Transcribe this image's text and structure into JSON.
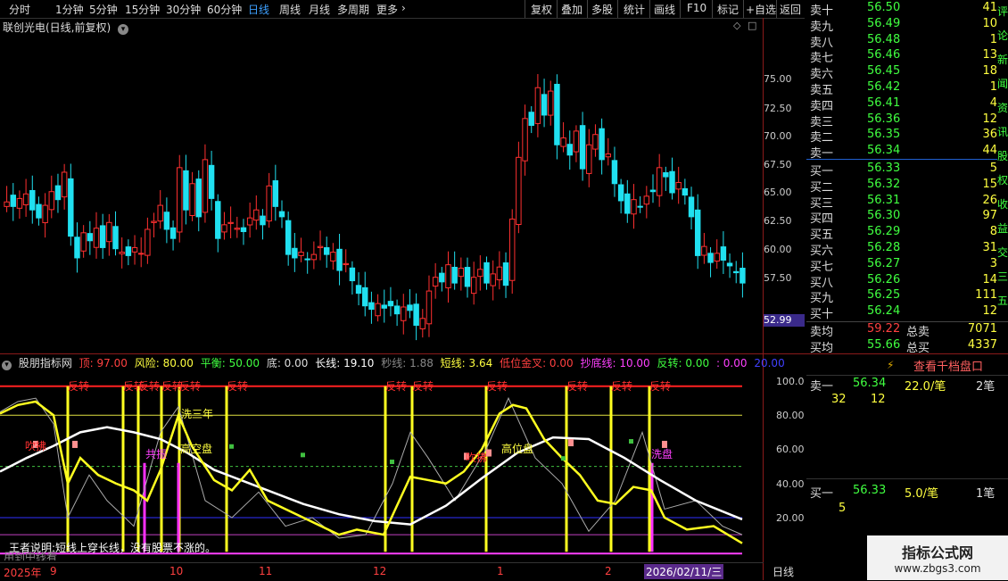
{
  "toolbar": {
    "periods": [
      "分时",
      "1分钟",
      "5分钟",
      "15分钟",
      "30分钟",
      "60分钟",
      "日线",
      "周线",
      "月线",
      "多周期",
      "更多"
    ],
    "active_period": "日线",
    "buttons": [
      "复权",
      "叠加",
      "多股",
      "统计",
      "画线",
      "F10",
      "标记",
      "+自选",
      "返回"
    ]
  },
  "chart_title": "联创光电(日线,前复权)",
  "price_axis": [
    "75.00",
    "72.50",
    "70.00",
    "67.50",
    "65.00",
    "62.50",
    "60.00",
    "57.50"
  ],
  "last_price_tag": "52.99",
  "indicator_axis": [
    "100.0",
    "80.00",
    "60.00",
    "40.00",
    "20.00"
  ],
  "date_axis": [
    "2025年",
    "9",
    "10",
    "11",
    "12",
    "1",
    "2",
    "2026/02/11/三",
    "日线"
  ],
  "indicator_legend": {
    "name": "股朋指标网",
    "items": [
      {
        "label": "顶: 97.00",
        "color": "#ff4040"
      },
      {
        "label": "风险: 80.00",
        "color": "#ffff40"
      },
      {
        "label": "平衡: 50.00",
        "color": "#40ff40"
      },
      {
        "label": "底: 0.00",
        "color": "#dddddd"
      },
      {
        "label": "长线: 19.10",
        "color": "#ffffff"
      },
      {
        "label": "秒线: 1.88",
        "color": "#888888"
      },
      {
        "label": "短线: 3.64",
        "color": "#ffff40"
      },
      {
        "label": "低位金叉: 0.00",
        "color": "#ff4040"
      },
      {
        "label": "抄底线: 10.00",
        "color": "#ff40ff"
      },
      {
        "label": "反转: 0.00",
        "color": "#40ff40"
      },
      {
        "label": ": 0.00",
        "color": "#ff40ff"
      },
      {
        "label": "20.00",
        "color": "#4040ff"
      }
    ]
  },
  "annotations": {
    "fanzhuan": "反转",
    "kouzhu": "吹拂",
    "gaokongpan": "高空盘",
    "gaowupan": "高位盘",
    "xisan": "洗三年",
    "gongjie": "共振",
    "xiyin": "洗盘",
    "motto": "王者说明:短线上穿长线，没有股票不涨的。",
    "motto2": "用到中线看"
  },
  "order_book": {
    "sell": [
      {
        "label": "卖十",
        "price": "56.50",
        "vol": "41"
      },
      {
        "label": "卖九",
        "price": "56.49",
        "vol": "10"
      },
      {
        "label": "卖八",
        "price": "56.48",
        "vol": "1"
      },
      {
        "label": "卖七",
        "price": "56.46",
        "vol": "13"
      },
      {
        "label": "卖六",
        "price": "56.45",
        "vol": "18"
      },
      {
        "label": "卖五",
        "price": "56.42",
        "vol": "1"
      },
      {
        "label": "卖四",
        "price": "56.41",
        "vol": "4"
      },
      {
        "label": "卖三",
        "price": "56.36",
        "vol": "12"
      },
      {
        "label": "卖二",
        "price": "56.35",
        "vol": "36"
      },
      {
        "label": "卖一",
        "price": "56.34",
        "vol": "44"
      }
    ],
    "buy": [
      {
        "label": "买一",
        "price": "56.33",
        "vol": "5"
      },
      {
        "label": "买二",
        "price": "56.32",
        "vol": "15"
      },
      {
        "label": "买三",
        "price": "56.31",
        "vol": "26"
      },
      {
        "label": "买四",
        "price": "56.30",
        "vol": "97"
      },
      {
        "label": "买五",
        "price": "56.29",
        "vol": "8"
      },
      {
        "label": "买六",
        "price": "56.28",
        "vol": "31"
      },
      {
        "label": "买七",
        "price": "56.27",
        "vol": "3"
      },
      {
        "label": "买八",
        "price": "56.26",
        "vol": "14"
      },
      {
        "label": "买九",
        "price": "56.25",
        "vol": "111"
      },
      {
        "label": "买十",
        "price": "56.24",
        "vol": "12"
      }
    ],
    "sell_avg_label": "卖均",
    "sell_avg": "59.22",
    "total_sell_label": "总卖",
    "total_sell": "7071",
    "buy_avg_label": "买均",
    "buy_avg": "55.66",
    "total_buy_label": "总买",
    "total_buy": "4337",
    "side_text": [
      "评",
      "论",
      "新",
      "闻",
      "资",
      "讯",
      "股",
      "权",
      "收",
      "益",
      "交",
      "三",
      "五"
    ]
  },
  "lower_panel": {
    "view_thousand": "查看千档盘口",
    "s1_label": "卖一",
    "s1_price": "56.34",
    "s1_per": "22.0/笔",
    "s1_count": "2笔",
    "s1_detail": [
      "32",
      "12"
    ],
    "b1_label": "买一",
    "b1_price": "56.33",
    "b1_per": "5.0/笔",
    "b1_count": "1笔",
    "b1_detail": [
      "5"
    ]
  },
  "watermark": {
    "title": "指标公式网",
    "url": "www.zbgs3.com"
  }
}
